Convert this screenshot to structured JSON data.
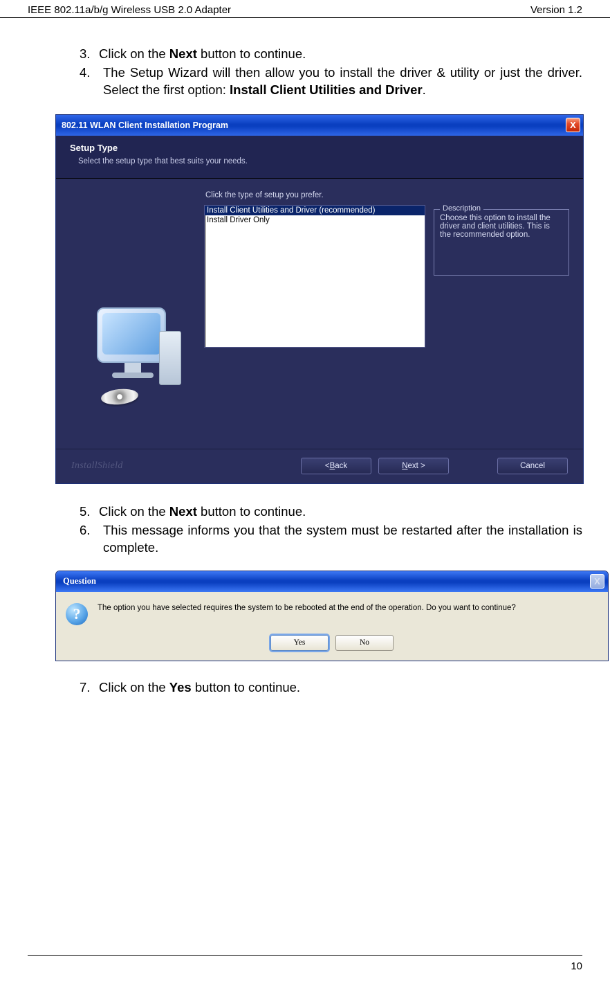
{
  "header": {
    "left": "IEEE 802.11a/b/g Wireless USB 2.0 Adapter",
    "right": "Version 1.2"
  },
  "steps_a": [
    {
      "num": "3.",
      "pre": "Click on the ",
      "bold": "Next",
      "post": " button to continue."
    },
    {
      "num": "4.",
      "pre": "The Setup Wizard will then allow you to install the driver & utility or just the driver. Select the first option: ",
      "bold": "Install Client Utilities and Driver",
      "post": "."
    }
  ],
  "installer": {
    "title": "802.11 WLAN Client Installation Program",
    "close": "X",
    "head1": "Setup Type",
    "head2": "Select the setup type that best suits your needs.",
    "prompt": "Click the type of setup you prefer.",
    "options": [
      "Install Client Utilities and Driver (recommended)",
      "Install Driver Only"
    ],
    "desc_legend": "Description",
    "desc_text": "Choose this option to install the driver and client utilities. This is the recommended option.",
    "ishield": "InstallShield",
    "back_u": "B",
    "back_rest": "ack",
    "next_u": "N",
    "next_rest": "ext >",
    "cancel": "Cancel"
  },
  "steps_b": [
    {
      "num": "5.",
      "pre": "Click on the ",
      "bold": "Next",
      "post": " button to continue."
    },
    {
      "num": "6.",
      "pre": "This message informs you that the system must be restarted after the installation is complete.",
      "bold": "",
      "post": ""
    }
  ],
  "question": {
    "title": "Question",
    "close": "X",
    "icon": "?",
    "text": "The option you have selected requires the system to be rebooted at the end of the operation. Do you want to continue?",
    "yes": "Yes",
    "no": "No"
  },
  "steps_c": [
    {
      "num": "7.",
      "pre": "Click on the ",
      "bold": "Yes",
      "post": " button to continue."
    }
  ],
  "page_num": "10"
}
